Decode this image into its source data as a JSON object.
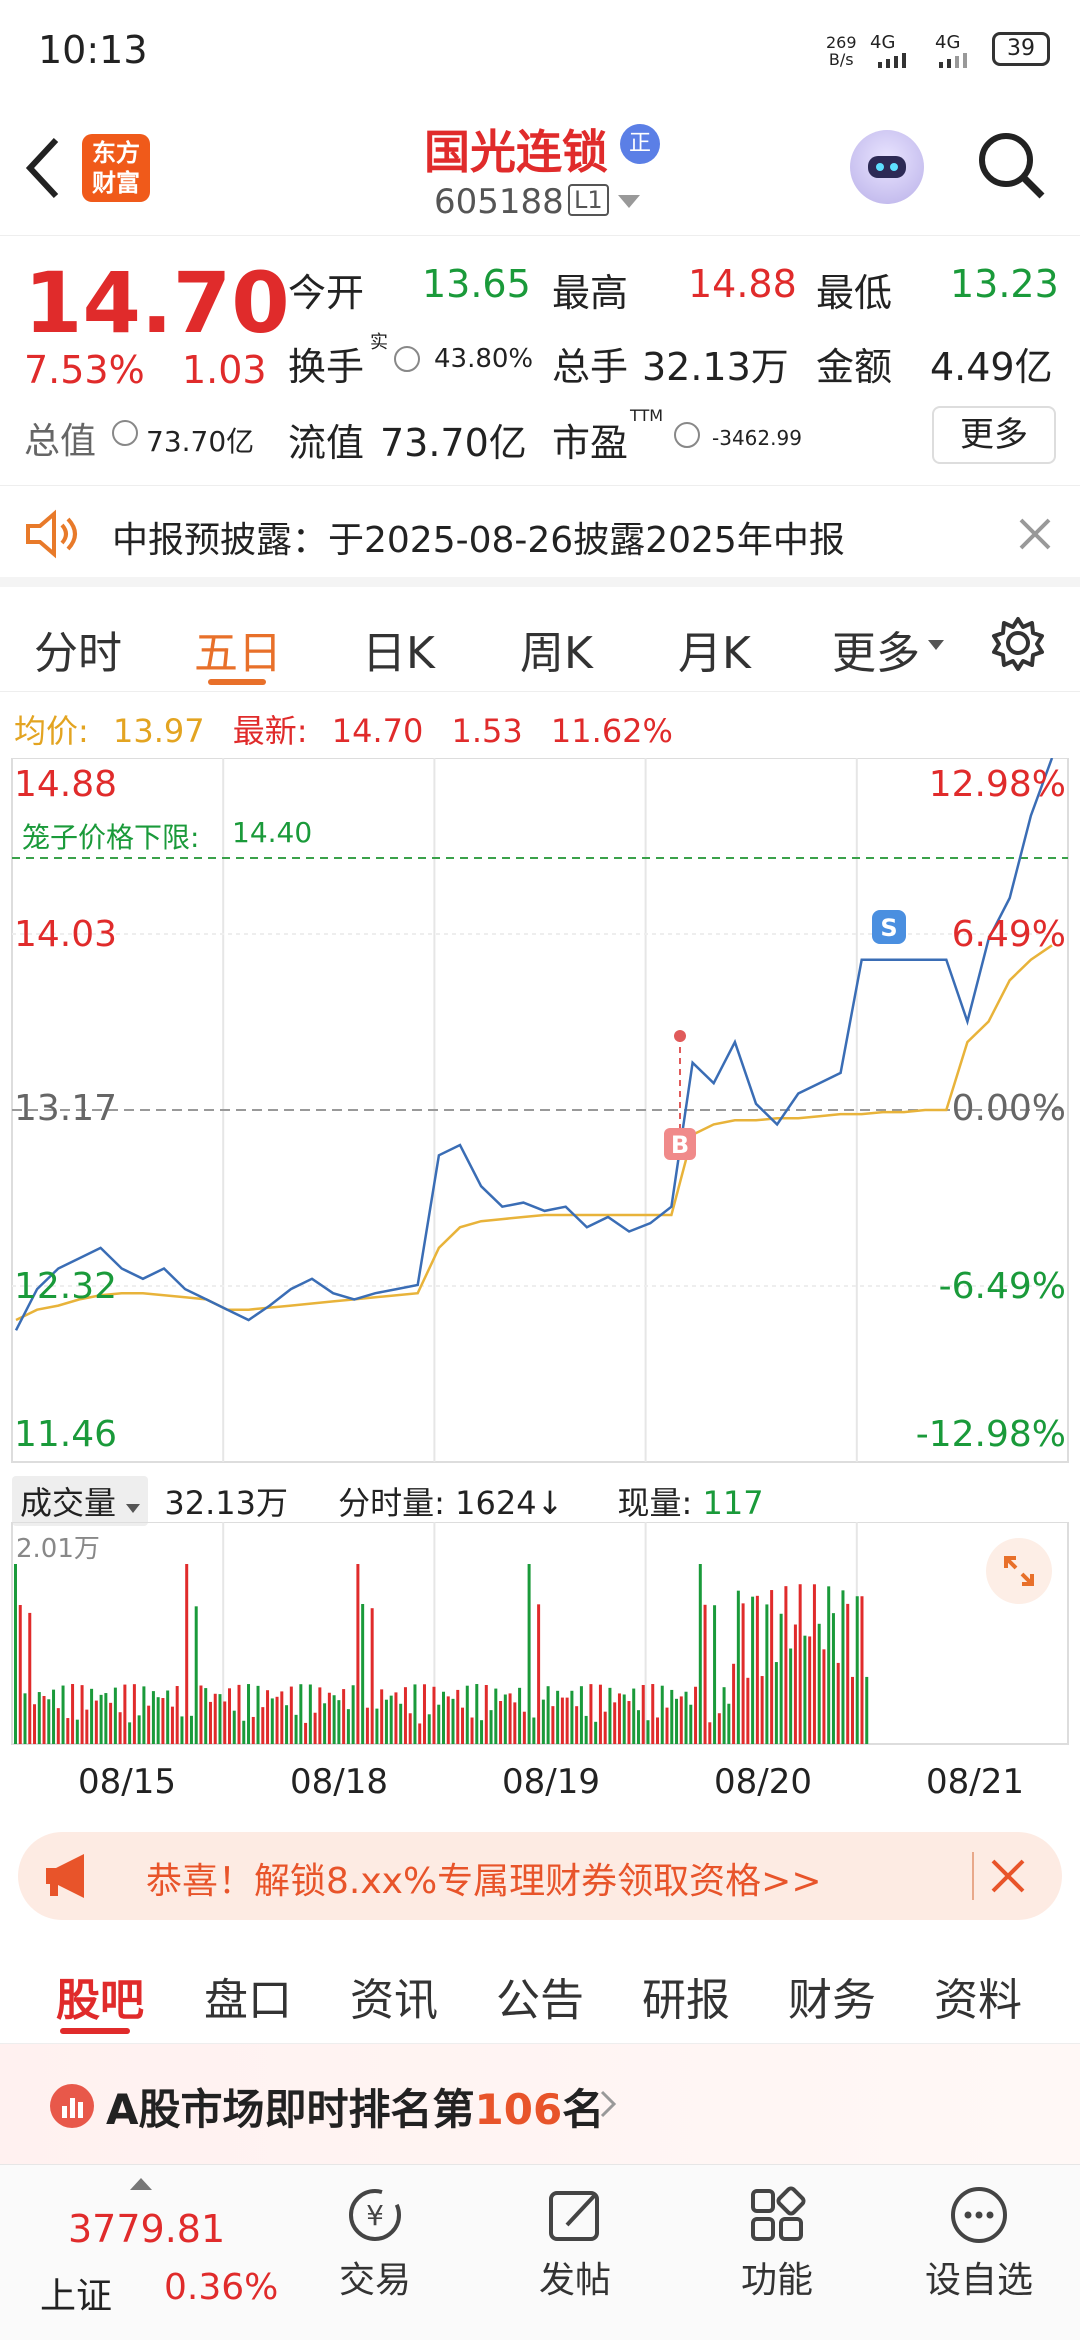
{
  "status": {
    "time": "10:13",
    "speed_top": "269",
    "speed_bottom": "B/s",
    "net1": "4G",
    "net2": "4G",
    "battery": "39"
  },
  "header": {
    "brand_top": "东方",
    "brand_bottom": "财富",
    "title": "国光连锁",
    "badge": "正",
    "code": "605188",
    "level": "L1"
  },
  "quote": {
    "price": "14.70",
    "change_pct": "7.53%",
    "change": "1.03",
    "open_label": "今开",
    "open": "13.65",
    "high_label": "最高",
    "high": "14.88",
    "low_label": "最低",
    "low": "13.23",
    "turnover_label": "换手",
    "turnover_sup": "实",
    "turnover": "43.80%",
    "volume_label": "总手",
    "volume": "32.13万",
    "amount_label": "金额",
    "amount": "4.49亿",
    "mktcap_label": "总值",
    "mktcap": "73.70亿",
    "float_label": "流值",
    "float": "73.70亿",
    "pe_label": "市盈",
    "pe_sup": "TTM",
    "pe": "-3462.99",
    "more": "更多"
  },
  "notice": {
    "text": "中报预披露：于2025-08-26披露2025年中报"
  },
  "tabs": [
    "分时",
    "五日",
    "日K",
    "周K",
    "月K",
    "更多"
  ],
  "chart_info": {
    "avg_label": "均价:",
    "avg": "13.97",
    "latest_label": "最新:",
    "latest": "14.70",
    "diff": "1.53",
    "pct": "11.62%"
  },
  "chart_data": {
    "type": "line",
    "left_ticks": [
      "14.88",
      "14.03",
      "13.17",
      "12.32",
      "11.46"
    ],
    "right_ticks": [
      "12.98%",
      "6.49%",
      "0.00%",
      "-6.49%",
      "-12.98%"
    ],
    "limit_label": "笼子价格下限:",
    "limit": "14.40",
    "ylim": [
      11.46,
      14.88
    ],
    "dates": [
      "08/15",
      "08/18",
      "08/19",
      "08/20",
      "08/21"
    ],
    "marker_b": "B",
    "marker_s": "S",
    "series": [
      {
        "values": [
          12.1,
          12.3,
          12.4,
          12.45,
          12.5,
          12.4,
          12.35,
          12.4,
          12.3,
          12.25,
          12.2,
          12.15,
          12.22,
          12.3,
          12.35,
          12.28,
          12.25,
          12.28,
          12.3,
          12.32,
          12.95,
          13.0,
          12.8,
          12.7,
          12.72,
          12.68,
          12.7,
          12.6,
          12.65,
          12.58,
          12.62,
          12.7,
          13.4,
          13.3,
          13.5,
          13.2,
          13.1,
          13.25,
          13.3,
          13.35,
          13.9,
          13.9,
          13.9,
          13.9,
          13.9,
          13.6,
          14.0,
          14.2,
          14.6,
          14.88
        ]
      },
      {
        "values": [
          12.15,
          12.2,
          12.22,
          12.25,
          12.27,
          12.28,
          12.28,
          12.27,
          12.26,
          12.25,
          12.2,
          12.2,
          12.21,
          12.22,
          12.23,
          12.24,
          12.25,
          12.26,
          12.27,
          12.28,
          12.5,
          12.6,
          12.63,
          12.64,
          12.65,
          12.66,
          12.66,
          12.66,
          12.66,
          12.66,
          12.66,
          12.66,
          13.05,
          13.1,
          13.12,
          13.12,
          13.13,
          13.13,
          13.14,
          13.15,
          13.15,
          13.16,
          13.16,
          13.17,
          13.17,
          13.5,
          13.6,
          13.8,
          13.9,
          13.97
        ]
      }
    ]
  },
  "volume": {
    "label": "成交量",
    "total": "32.13万",
    "fen_label": "分时量:",
    "fen": "1624↓",
    "now_label": "现量:",
    "now": "117",
    "max": "2.01万"
  },
  "promo": {
    "text": "恭喜！解锁8.xx%专属理财券领取资格>>"
  },
  "bottom_tabs": [
    "股吧",
    "盘口",
    "资讯",
    "公告",
    "研报",
    "财务",
    "资料"
  ],
  "rank": {
    "prefix": "A股市场即时排名第",
    "num": "106",
    "suffix": "名"
  },
  "nav": {
    "index_value": "3779.81",
    "index_name": "上证",
    "index_pct": "0.36%",
    "items": [
      "交易",
      "发帖",
      "功能",
      "设自选"
    ]
  }
}
